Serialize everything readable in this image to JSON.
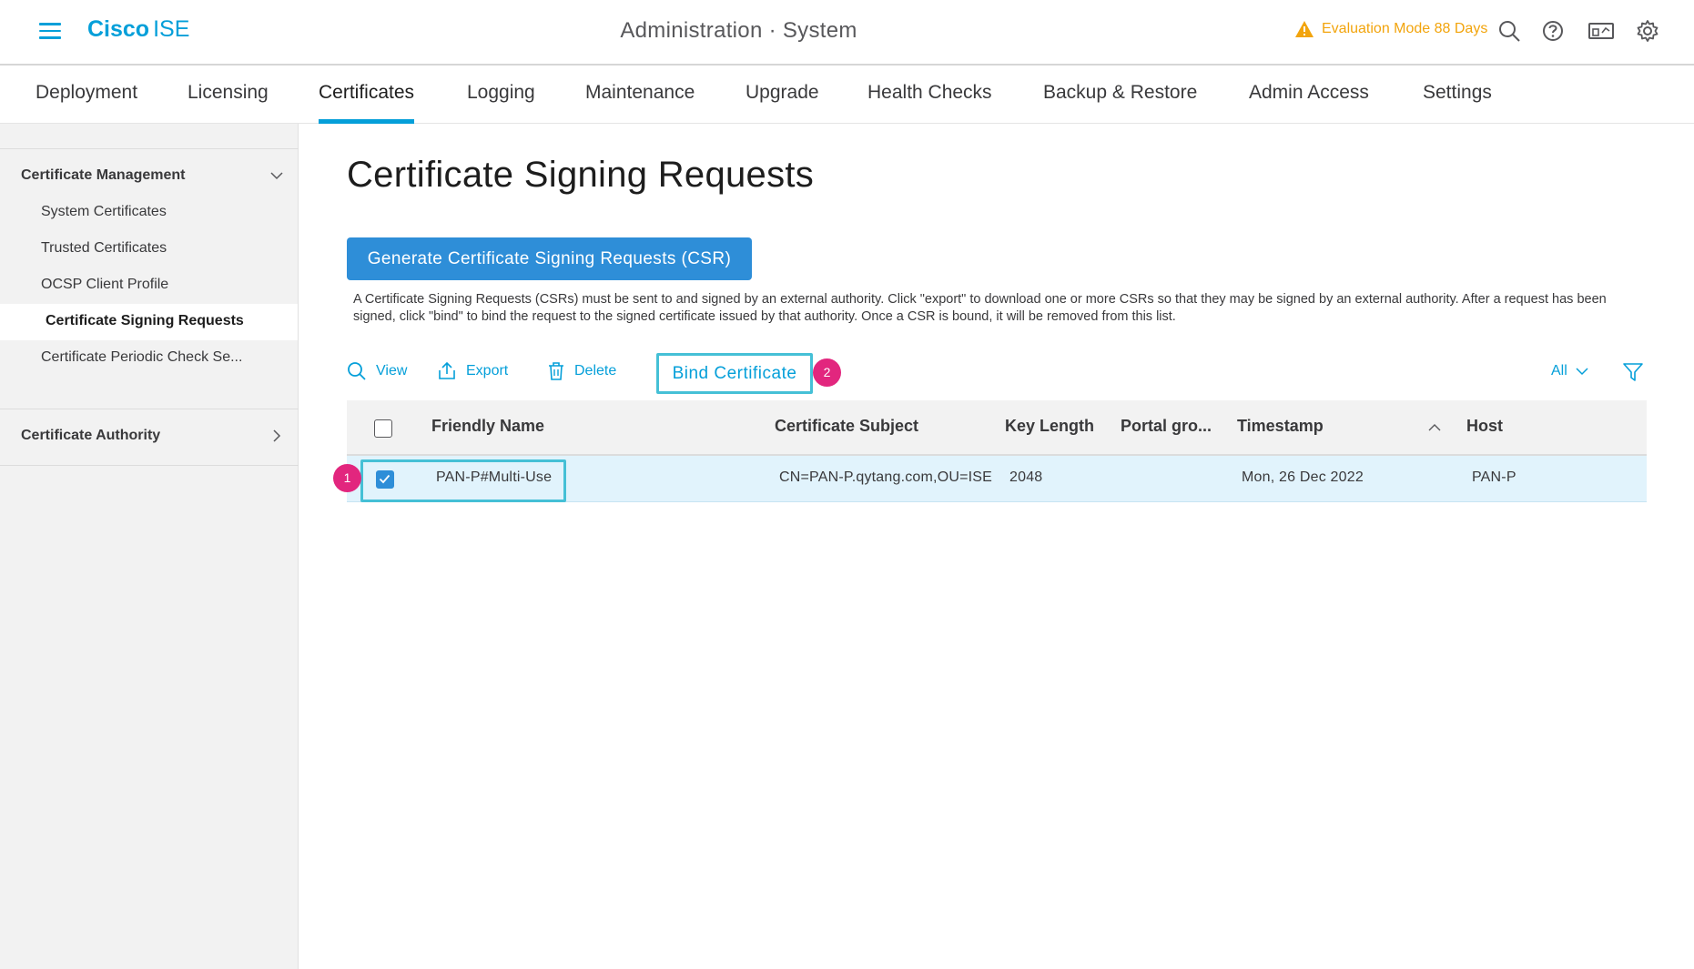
{
  "header": {
    "brand_bold": "Cisco",
    "brand_light": "ISE",
    "context": "Administration · System",
    "eval_text": "Evaluation Mode 88 Days",
    "accent_color": "#049fd9",
    "warn_color": "#f2a40c"
  },
  "tabs": [
    {
      "label": "Deployment",
      "active": false
    },
    {
      "label": "Licensing",
      "active": false
    },
    {
      "label": "Certificates",
      "active": true
    },
    {
      "label": "Logging",
      "active": false
    },
    {
      "label": "Maintenance",
      "active": false
    },
    {
      "label": "Upgrade",
      "active": false
    },
    {
      "label": "Health Checks",
      "active": false
    },
    {
      "label": "Backup & Restore",
      "active": false
    },
    {
      "label": "Admin Access",
      "active": false
    },
    {
      "label": "Settings",
      "active": false
    }
  ],
  "sidebar": {
    "section1": "Certificate Management",
    "items": [
      {
        "label": "System Certificates"
      },
      {
        "label": "Trusted Certificates"
      },
      {
        "label": "OCSP Client Profile"
      },
      {
        "label": "Certificate Signing Requests",
        "active": true
      },
      {
        "label": "Certificate Periodic Check Se..."
      }
    ],
    "section2": "Certificate Authority"
  },
  "main": {
    "title": "Certificate Signing Requests",
    "generate_button": "Generate Certificate Signing Requests (CSR)",
    "description": "A Certificate Signing Requests (CSRs) must be sent to and signed by an external authority. Click \"export\" to download one or more CSRs so that they may be signed by an external authority. After a request has been signed, click \"bind\" to bind the request to the signed certificate issued by that authority. Once a CSR is bound, it will be removed from this list."
  },
  "toolbar": {
    "view": "View",
    "export": "Export",
    "delete": "Delete",
    "bind": "Bind Certificate",
    "filter": "All"
  },
  "steps": {
    "step1": "1",
    "step2": "2"
  },
  "table": {
    "columns": [
      "Friendly Name",
      "Certificate Subject",
      "Key Length",
      "Portal gro...",
      "Timestamp",
      "Host"
    ],
    "rows": [
      {
        "selected": true,
        "friendly_name": "PAN-P#Multi-Use",
        "certificate_subject": "CN=PAN-P.qytang.com,OU=ISE",
        "key_length": "2048",
        "portal_group": "",
        "timestamp": "Mon, 26 Dec 2022",
        "host": "PAN-P"
      }
    ]
  }
}
